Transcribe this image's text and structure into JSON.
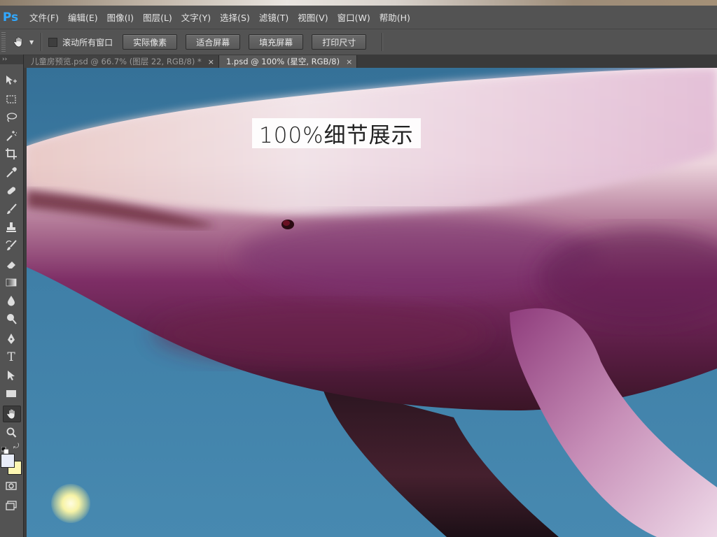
{
  "app": {
    "logo": "Ps"
  },
  "menu": [
    "文件(F)",
    "编辑(E)",
    "图像(I)",
    "图层(L)",
    "文字(Y)",
    "选择(S)",
    "滤镜(T)",
    "视图(V)",
    "窗口(W)",
    "帮助(H)"
  ],
  "options_bar": {
    "tool_icon": "hand-icon",
    "scroll_all_label": "滚动所有窗口",
    "scroll_all_checked": false,
    "buttons": [
      "实际像素",
      "适合屏幕",
      "填充屏幕",
      "打印尺寸"
    ]
  },
  "tabs": [
    {
      "label": "儿童房预览.psd @ 66.7% (图层 22, RGB/8) *",
      "close": "×",
      "active": false
    },
    {
      "label": "1.psd @ 100% (星空, RGB/8)",
      "close": "×",
      "active": true
    }
  ],
  "tools": [
    "move-icon",
    "marquee-icon",
    "lasso-icon",
    "magic-wand-icon",
    "crop-icon",
    "eyedropper-icon",
    "healing-brush-icon",
    "brush-icon",
    "clone-stamp-icon",
    "history-brush-icon",
    "eraser-icon",
    "gradient-icon",
    "blur-icon",
    "dodge-icon",
    "pen-icon",
    "type-icon",
    "path-select-icon",
    "rectangle-icon",
    "hand-icon",
    "zoom-icon"
  ],
  "tool_panel": {
    "collapse": "››",
    "type_glyph": "T"
  },
  "active_tool": "hand-icon",
  "colors": {
    "foreground": "#e8ecf8",
    "background": "#fdf6b2",
    "accent": "#31a8ff"
  },
  "canvas": {
    "detail_label": "100%细节展示"
  }
}
